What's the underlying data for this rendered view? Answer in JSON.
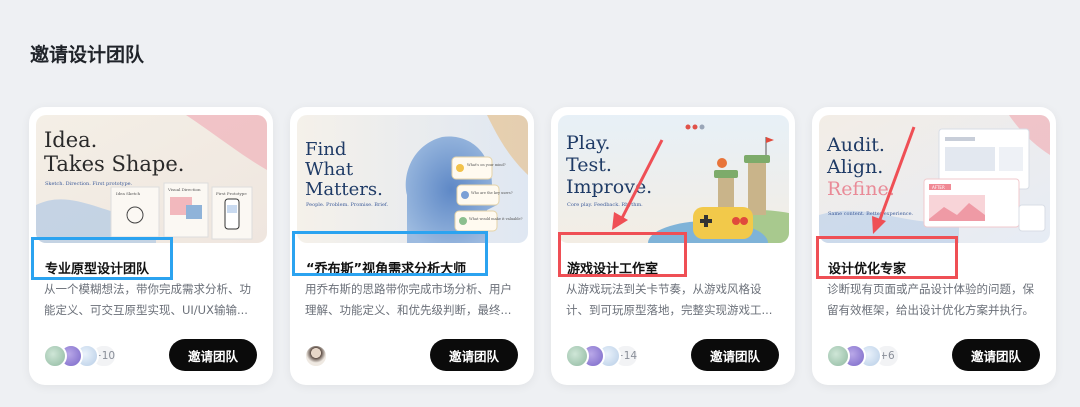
{
  "page": {
    "title": "邀请设计团队"
  },
  "colors": {
    "accent_blue": "#2ba3f0",
    "accent_red": "#ef4f55",
    "button_bg": "#0b0b0b"
  },
  "cards": [
    {
      "thumb": {
        "headline": [
          "Idea.",
          "Takes Shape."
        ],
        "tagline": "Sketch. Direction. First prototype.",
        "panels": [
          "Idea Sketch",
          "Visual Direction",
          "First Prototype"
        ]
      },
      "name": "专业原型设计团队",
      "desc": "从一个模糊想法，带你完成需求分析、功能定义、可交互原型实现、UI/UX输输...",
      "member_count": "+10",
      "button": "邀请团队"
    },
    {
      "thumb": {
        "headline": [
          "Find",
          "What",
          "Matters."
        ],
        "tagline": "People. Problem. Promise. Brief.",
        "bubbles": [
          "What's on your mind?",
          "Who are the key users?",
          "What would make it valuable?"
        ]
      },
      "name": "“乔布斯”视角需求分析大师",
      "desc": "用乔布斯的思路带你完成市场分析、用户理解、功能定义、和优先级判断，最终...",
      "member_count": "",
      "button": "邀请团队"
    },
    {
      "thumb": {
        "headline": [
          "Play.",
          "Test.",
          "Improve."
        ],
        "tagline": "Core play. Feedback. Rhythm."
      },
      "name": "游戏设计工作室",
      "desc": "从游戏玩法到关卡节奏，从游戏风格设计、到可玩原型落地，完整实现游戏工...",
      "member_count": "+14",
      "button": "邀请团队"
    },
    {
      "thumb": {
        "headline": [
          "Audit.",
          "Align.",
          "Refine."
        ],
        "tagline": "Same content. Better experience.",
        "badge": "AFTER"
      },
      "name": "设计优化专家",
      "desc": "诊断现有页面或产品设计体验的问题，保留有效框架，给出设计优化方案并执行。",
      "member_count": "+6",
      "button": "邀请团队"
    }
  ]
}
